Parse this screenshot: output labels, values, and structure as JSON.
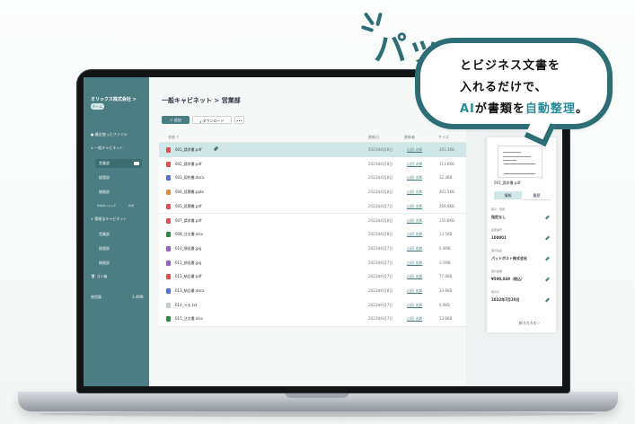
{
  "brand": {
    "colors": {
      "teal": "#4b7e82",
      "bubble_border": "#2c6d76",
      "accent": "#2a8c9b",
      "selected_row": "#cfe7e7"
    }
  },
  "callout": {
    "sound": "パッ",
    "line1": "とビジネス文書を",
    "line2": "入れるだけで、",
    "line3_prefix": "AI",
    "line3_middle": "が書類を",
    "line3_highlight": "自動整理",
    "line3_suffix": "。"
  },
  "sidebar": {
    "company": "オリックス株式会社 >",
    "home": "ホーム",
    "items": {
      "recent": "● 最近使ったファイル",
      "general": "∨ 一般キャビネット",
      "electronic": "∨ 電帳法キャビネット",
      "trash": "🗑 ゴミ箱"
    },
    "folders": {
      "sales": "営業部",
      "accounting": "経理部",
      "general_affairs": "総務部",
      "sales2": "営業部",
      "accounting2": "経理部",
      "general_affairs2": "総務部"
    },
    "caption_left": "作成中フォルダ",
    "caption_right": "作成",
    "storage_label": "使用量",
    "storage_value": "3.4MB"
  },
  "main": {
    "title": "一般キャビネット > 営業部",
    "toolbar": {
      "add": "+ 追加",
      "download": "⤓ ダウンロード",
      "more": "•••"
    },
    "headers": {
      "name": "名前 ↑",
      "date": "更新日",
      "owner": "更新者",
      "size": "サイズ"
    },
    "files": [
      {
        "name": "001_請求書.pdf",
        "date": "2023年6月8日",
        "owner": "山田 太郎",
        "size": "201.3KB",
        "type": "pdf",
        "selected": true
      },
      {
        "name": "002_請求書.pdf",
        "date": "2023年6月8日",
        "owner": "山田 太郎",
        "size": "111.6KB",
        "type": "pdf"
      },
      {
        "name": "003_契約書.docx",
        "date": "2023年6月8日",
        "owner": "山田 太郎",
        "size": "32.4KB",
        "type": "docx"
      },
      {
        "name": "004_見積書.pptx",
        "date": "2023年6月8日",
        "owner": "山田 太郎",
        "size": "401.5KB",
        "type": "pptx"
      },
      {
        "name": "005_見積書.pdf",
        "date": "2023年6月7日",
        "owner": "山田 太郎",
        "size": "269.9KB",
        "type": "pdf"
      },
      {
        "name": "007_請求書.pdf",
        "date": "2023年6月8日",
        "owner": "山田 太郎",
        "size": "150.8KB",
        "type": "pdf"
      },
      {
        "name": "008_注文書.xlsx",
        "date": "2023年6月8日",
        "owner": "山田 太郎",
        "size": "13.5KB",
        "type": "xlsx"
      },
      {
        "name": "010_領収書.jpg",
        "date": "2023年6月7日",
        "owner": "山田 太郎",
        "size": "2.4MB",
        "type": "jpg"
      },
      {
        "name": "011_領収書.jpg",
        "date": "2023年6月7日",
        "owner": "山田 太郎",
        "size": "3.5MB",
        "type": "jpg"
      },
      {
        "name": "012_納品書.pdf",
        "date": "2023年6月7日",
        "owner": "山田 太郎",
        "size": "77.4KB",
        "type": "pdf"
      },
      {
        "name": "013_納品書.docx",
        "date": "2023年6月8日",
        "owner": "山田 太郎",
        "size": "33.6KB",
        "type": "docx"
      },
      {
        "name": "014_メモ.txt",
        "date": "2023年6月7日",
        "owner": "山田 太郎",
        "size": "0.9KB",
        "type": "txt"
      },
      {
        "name": "015_注文書.xlsx",
        "date": "2023年6月7日",
        "owner": "山田 太郎",
        "size": "13.6KB",
        "type": "xlsx"
      }
    ]
  },
  "details": {
    "file": "001_請求書.pdf",
    "tabs": {
      "basic": "情報",
      "history": "履歴"
    },
    "fields": [
      {
        "label": "取引・登録",
        "value": "指定なし"
      },
      {
        "label": "証憑番号",
        "value": "100001"
      },
      {
        "label": "取引先名",
        "value": "パットボスト株式会社"
      },
      {
        "label": "取引金額",
        "value": "¥500,049（税込）"
      },
      {
        "label": "取引日",
        "value": "2022年7月20日"
      }
    ],
    "collapse": "折りたたむ ›"
  }
}
